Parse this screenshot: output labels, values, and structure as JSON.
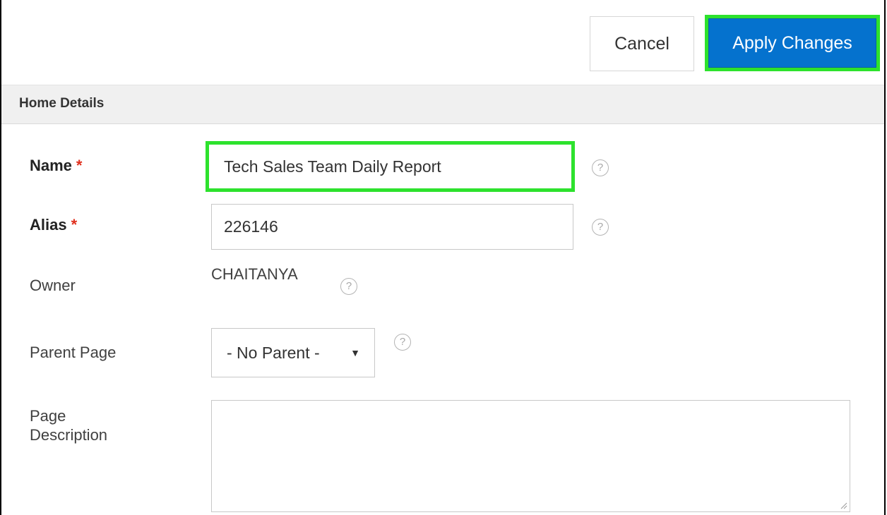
{
  "toolbar": {
    "cancel_label": "Cancel",
    "apply_label": "Apply Changes"
  },
  "section": {
    "title": "Home Details"
  },
  "form": {
    "name": {
      "label": "Name",
      "required_mark": "*",
      "value": "Tech Sales Team Daily Report"
    },
    "alias": {
      "label": "Alias",
      "required_mark": "*",
      "value": "226146"
    },
    "owner": {
      "label": "Owner",
      "value": "CHAITANYA"
    },
    "parent_page": {
      "label": "Parent Page",
      "selected": "- No Parent -"
    },
    "page_description": {
      "label_line1": "Page",
      "label_line2": "Description",
      "value": ""
    }
  },
  "help_icon_glyph": "?",
  "colors": {
    "apply_bg": "#0572ce",
    "highlight": "#2de22d",
    "required": "#e0301e",
    "section_bg": "#f0f0f0"
  },
  "icons": [
    "help-icon",
    "chevron-down-icon",
    "resize-grip-icon"
  ]
}
